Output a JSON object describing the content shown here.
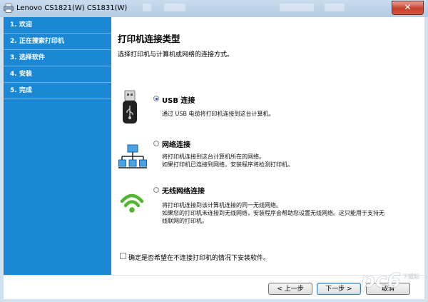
{
  "window": {
    "title": "Lenovo CS1821(W) CS1831(W)",
    "close_label": "✕"
  },
  "steps": [
    {
      "label": "1. 欢迎"
    },
    {
      "label": "2. 正在搜索打印机"
    },
    {
      "label": "3. 选择软件"
    },
    {
      "label": "4. 安装"
    },
    {
      "label": "5. 完成"
    }
  ],
  "content": {
    "heading": "打印机连接类型",
    "subtitle": "选择打印机与计算机或网络的连接方式。",
    "options": [
      {
        "label": "USB 连接",
        "selected": true,
        "icon": "usb-icon",
        "description": [
          "通过 USB 电缆将打印机连接到这台计算机。"
        ]
      },
      {
        "label": "网络连接",
        "selected": false,
        "icon": "network-icon",
        "description": [
          "将打印机连接到这台计算机所在的网络。",
          "如果打印机已连接到网络，安装程序将检测打印机。"
        ]
      },
      {
        "label": "无线网络连接",
        "selected": false,
        "icon": "wifi-icon",
        "description": [
          "将打印机连接到该计算机连接的同一无线网络。",
          "如果您的打印机未连接到无线网络，安装程序会帮助您设置无线网络。这只能用于支持无",
          "线联网的打印机。"
        ]
      }
    ],
    "checkbox_label": "确定是否希望在不连接打印机的情况下安装软件。",
    "checkbox_checked": false
  },
  "footer": {
    "back_label": "< 上一步",
    "next_label": "下一步 >",
    "cancel_label": "取消"
  },
  "watermark": {
    "text": "pc6",
    "subtext": "下载站"
  },
  "colors": {
    "sidebar": "#1b88d5",
    "close": "#c7422b"
  }
}
